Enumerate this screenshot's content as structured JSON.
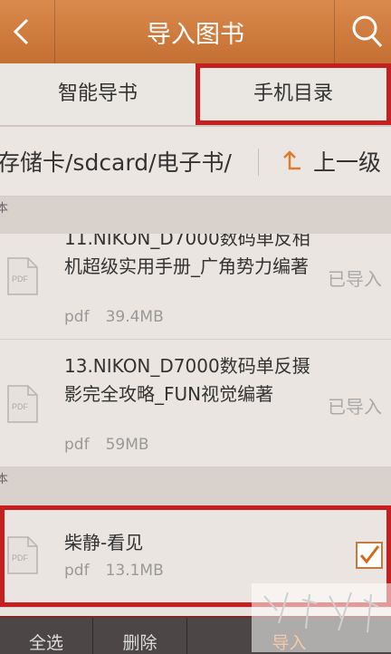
{
  "header": {
    "title": "导入图书",
    "back_icon": "chevron-left-icon",
    "search_icon": "search-icon"
  },
  "tabs": [
    {
      "label": "智能导书",
      "selected": false
    },
    {
      "label": "手机目录",
      "selected": true
    }
  ],
  "path": {
    "text": "存储卡/sdcard/电子书/",
    "up_label": "上一级"
  },
  "sections": [
    {
      "label": "本"
    },
    {
      "label": "本"
    }
  ],
  "files": [
    {
      "name": "11.NIKON_D7000数码单反相机超级实用手册_广角势力编著",
      "type": "pdf",
      "size": "39.4MB",
      "status": "已导入"
    },
    {
      "name": "13.NIKON_D7000数码单反摄影完全攻略_FUN视觉编著",
      "type": "pdf",
      "size": "59MB",
      "status": "已导入"
    },
    {
      "name": "柴静-看见",
      "type": "pdf",
      "size": "13.1MB",
      "checked": true
    }
  ],
  "bottom": {
    "select_all": "全选",
    "delete": "删除",
    "import": "导入"
  },
  "colors": {
    "accent": "#c56f33",
    "highlight_red": "#c61f1f"
  }
}
